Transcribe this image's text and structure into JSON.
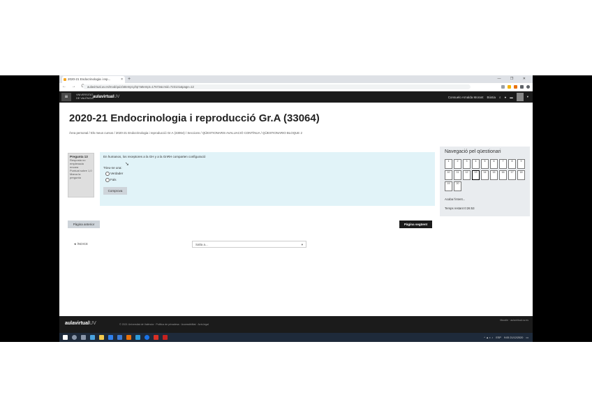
{
  "browser": {
    "tab_title": "2020-21 Endocrinologia i rep...",
    "tab_close": "×",
    "new_tab": "+",
    "window_controls": "—  ❐  ✕",
    "nav_buttons": "←  →  C",
    "url": "aulavirtual.uv.es/mod/quiz/attempt.php?attempt=17672&cmid=723131&page=12"
  },
  "site": {
    "university": [
      "VNIVERSITAT",
      "DE VALÈNCIA"
    ],
    "brand_main": "aulavirtual",
    "brand_suffix": "UV",
    "user_name": "Consuelo Arnalda Morant",
    "user_menu": "Bústia"
  },
  "course": {
    "title": "2020-21 Endocrinologia i reproducció Gr.A (33064)",
    "breadcrumb": "Àrea personal  /  Els meus cursos  /  2020-21 Endocrinologia i reproducció Gr.A (33064)  /  Seccions  /  QÜESTIONARIS AVALUACIÓ CONTÍNUA  /  QÜESTIONARIO BLOQUE 2"
  },
  "question": {
    "number_label": "Pregunta 13",
    "status": "Resposta no emplenada encara",
    "marks": "Puntuat sobre 1,0",
    "flag": "Marca la pregunta",
    "text": "En humanos, los receptores a la GH y a la GnRH comparten configuració",
    "select_prompt": "Trieu-ne una:",
    "options": [
      "Verdader",
      "Fals"
    ],
    "check_button": "Comprova"
  },
  "quiz_nav": {
    "title": "Navegació pel qüestionari",
    "cells": [
      "1",
      "2",
      "3",
      "4",
      "5",
      "6",
      "7",
      "8",
      "9",
      "10",
      "11",
      "12",
      "13",
      "14",
      "15",
      "16",
      "17",
      "18",
      "19",
      "20"
    ],
    "current": 13,
    "finish_link": "Acaba l'intent...",
    "time_label": "Temps restant 0:26:53"
  },
  "navigation": {
    "prev_button": "Pàgina anterior",
    "next_button": "Pàgina següent",
    "back_link": "◄ ÍNDICE",
    "jump_placeholder": "Salta a...",
    "jump_caret": "▾"
  },
  "footer": {
    "brand_main": "aulavirtual",
    "brand_suffix": "UV",
    "text": "© 2021 Universitat de València  ·  Política de privadesa  ·  Accessibilitat  ·  Avís legal",
    "right": "Moodle · aulavirtual.uv.es"
  },
  "taskbar": {
    "time": "9:05",
    "date": "21/12/2020",
    "lang": "ESP"
  },
  "colors": {
    "navbar": "#1b1b1b",
    "question_bg": "#e1f3f8",
    "quiz_nav_bg": "#e9ecef",
    "taskbar": "#1e2a3a"
  }
}
